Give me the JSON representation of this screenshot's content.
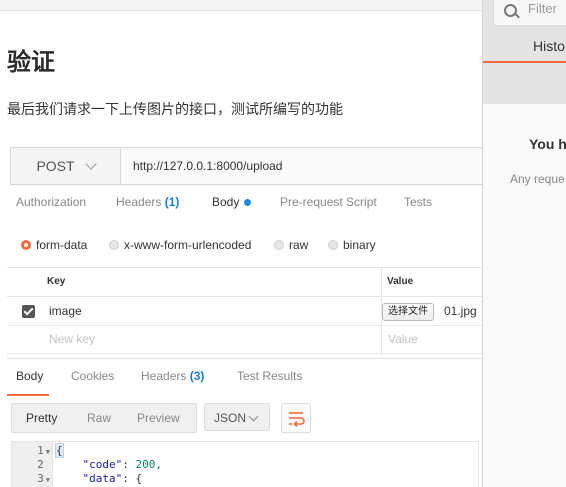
{
  "article": {
    "heading": "验证",
    "paragraph": "最后我们请求一下上传图片的接口，测试所编写的功能"
  },
  "request": {
    "method": "POST",
    "url": "http://127.0.0.1:8000/upload",
    "tabs": {
      "authorization": "Authorization",
      "headers": "Headers",
      "headers_count": "(1)",
      "body": "Body",
      "prerequest": "Pre-request Script",
      "tests": "Tests"
    },
    "body_types": [
      "form-data",
      "x-www-form-urlencoded",
      "raw",
      "binary"
    ],
    "selected_body_type": "form-data",
    "table": {
      "key_header": "Key",
      "value_header": "Value",
      "rows": [
        {
          "checked": true,
          "key": "image",
          "file_button": "选择文件",
          "file_name": "01.jpg"
        }
      ],
      "new_key_placeholder": "New key",
      "new_value_placeholder": "Value"
    }
  },
  "response": {
    "tabs": {
      "body": "Body",
      "cookies": "Cookies",
      "headers": "Headers",
      "headers_count": "(3)",
      "test_results": "Test Results"
    },
    "view_modes": [
      "Pretty",
      "Raw",
      "Preview"
    ],
    "active_view": "Pretty",
    "format": "JSON",
    "code_lines": [
      {
        "n": "1",
        "fold": true,
        "text": "{"
      },
      {
        "n": "2",
        "fold": false,
        "key": "\"code\"",
        "value": "200,"
      },
      {
        "n": "3",
        "fold": true,
        "key": "\"data\"",
        "value": "{"
      }
    ]
  },
  "history_panel": {
    "search_placeholder": "Filter",
    "tab": "Histo",
    "title": "You h",
    "subtitle": "Any reque"
  },
  "colors": {
    "accent": "#f26b3a",
    "count_blue": "#1a7fd4",
    "body_dot": "#1e88e5"
  }
}
